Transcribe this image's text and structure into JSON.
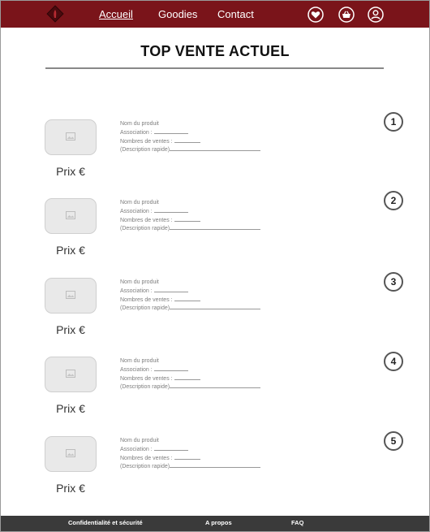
{
  "nav": {
    "links": [
      "Accueil",
      "Goodies",
      "Contact"
    ],
    "active": "Accueil"
  },
  "header_icons": [
    "heart-icon",
    "basket-icon",
    "account-icon"
  ],
  "page_title": "TOP VENTE ACTUEL",
  "products": [
    {
      "rank": "1",
      "price": "Prix €",
      "name": "Nom du produit",
      "association": "Association :",
      "sales": "Nombres de ventes :",
      "description": "(Description rapide)"
    },
    {
      "rank": "2",
      "price": "Prix €",
      "name": "Nom du produit",
      "association": "Association :",
      "sales": "Nombres de ventes :",
      "description": "(Description rapide)"
    },
    {
      "rank": "3",
      "price": "Prix €",
      "name": "Nom du produit",
      "association": "Association :",
      "sales": "Nombres de ventes :",
      "description": "(Description rapide)"
    },
    {
      "rank": "4",
      "price": "Prix €",
      "name": "Nom du produit",
      "association": "Association :",
      "sales": "Nombres de ventes :",
      "description": "(Description rapide)"
    },
    {
      "rank": "5",
      "price": "Prix €",
      "name": "Nom du produit",
      "association": "Association :",
      "sales": "Nombres de ventes :",
      "description": "(Description rapide)"
    }
  ],
  "footer": {
    "links": [
      "Confidentialité et sécurité",
      "A propos",
      "FAQ"
    ]
  },
  "colors": {
    "header_bg": "#7a141a",
    "footer_bg": "#3a3a3a"
  }
}
